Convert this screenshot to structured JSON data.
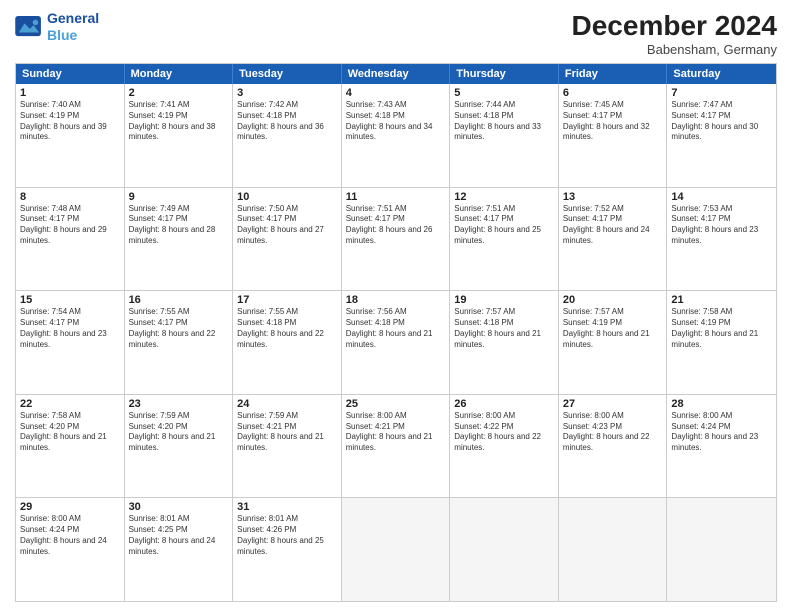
{
  "header": {
    "logo_line1": "General",
    "logo_line2": "Blue",
    "month": "December 2024",
    "location": "Babensham, Germany"
  },
  "days_of_week": [
    "Sunday",
    "Monday",
    "Tuesday",
    "Wednesday",
    "Thursday",
    "Friday",
    "Saturday"
  ],
  "weeks": [
    [
      {
        "day": "1",
        "sunrise": "7:40 AM",
        "sunset": "4:19 PM",
        "daylight": "8 hours and 39 minutes."
      },
      {
        "day": "2",
        "sunrise": "7:41 AM",
        "sunset": "4:19 PM",
        "daylight": "8 hours and 38 minutes."
      },
      {
        "day": "3",
        "sunrise": "7:42 AM",
        "sunset": "4:18 PM",
        "daylight": "8 hours and 36 minutes."
      },
      {
        "day": "4",
        "sunrise": "7:43 AM",
        "sunset": "4:18 PM",
        "daylight": "8 hours and 34 minutes."
      },
      {
        "day": "5",
        "sunrise": "7:44 AM",
        "sunset": "4:18 PM",
        "daylight": "8 hours and 33 minutes."
      },
      {
        "day": "6",
        "sunrise": "7:45 AM",
        "sunset": "4:17 PM",
        "daylight": "8 hours and 32 minutes."
      },
      {
        "day": "7",
        "sunrise": "7:47 AM",
        "sunset": "4:17 PM",
        "daylight": "8 hours and 30 minutes."
      }
    ],
    [
      {
        "day": "8",
        "sunrise": "7:48 AM",
        "sunset": "4:17 PM",
        "daylight": "8 hours and 29 minutes."
      },
      {
        "day": "9",
        "sunrise": "7:49 AM",
        "sunset": "4:17 PM",
        "daylight": "8 hours and 28 minutes."
      },
      {
        "day": "10",
        "sunrise": "7:50 AM",
        "sunset": "4:17 PM",
        "daylight": "8 hours and 27 minutes."
      },
      {
        "day": "11",
        "sunrise": "7:51 AM",
        "sunset": "4:17 PM",
        "daylight": "8 hours and 26 minutes."
      },
      {
        "day": "12",
        "sunrise": "7:51 AM",
        "sunset": "4:17 PM",
        "daylight": "8 hours and 25 minutes."
      },
      {
        "day": "13",
        "sunrise": "7:52 AM",
        "sunset": "4:17 PM",
        "daylight": "8 hours and 24 minutes."
      },
      {
        "day": "14",
        "sunrise": "7:53 AM",
        "sunset": "4:17 PM",
        "daylight": "8 hours and 23 minutes."
      }
    ],
    [
      {
        "day": "15",
        "sunrise": "7:54 AM",
        "sunset": "4:17 PM",
        "daylight": "8 hours and 23 minutes."
      },
      {
        "day": "16",
        "sunrise": "7:55 AM",
        "sunset": "4:17 PM",
        "daylight": "8 hours and 22 minutes."
      },
      {
        "day": "17",
        "sunrise": "7:55 AM",
        "sunset": "4:18 PM",
        "daylight": "8 hours and 22 minutes."
      },
      {
        "day": "18",
        "sunrise": "7:56 AM",
        "sunset": "4:18 PM",
        "daylight": "8 hours and 21 minutes."
      },
      {
        "day": "19",
        "sunrise": "7:57 AM",
        "sunset": "4:18 PM",
        "daylight": "8 hours and 21 minutes."
      },
      {
        "day": "20",
        "sunrise": "7:57 AM",
        "sunset": "4:19 PM",
        "daylight": "8 hours and 21 minutes."
      },
      {
        "day": "21",
        "sunrise": "7:58 AM",
        "sunset": "4:19 PM",
        "daylight": "8 hours and 21 minutes."
      }
    ],
    [
      {
        "day": "22",
        "sunrise": "7:58 AM",
        "sunset": "4:20 PM",
        "daylight": "8 hours and 21 minutes."
      },
      {
        "day": "23",
        "sunrise": "7:59 AM",
        "sunset": "4:20 PM",
        "daylight": "8 hours and 21 minutes."
      },
      {
        "day": "24",
        "sunrise": "7:59 AM",
        "sunset": "4:21 PM",
        "daylight": "8 hours and 21 minutes."
      },
      {
        "day": "25",
        "sunrise": "8:00 AM",
        "sunset": "4:21 PM",
        "daylight": "8 hours and 21 minutes."
      },
      {
        "day": "26",
        "sunrise": "8:00 AM",
        "sunset": "4:22 PM",
        "daylight": "8 hours and 22 minutes."
      },
      {
        "day": "27",
        "sunrise": "8:00 AM",
        "sunset": "4:23 PM",
        "daylight": "8 hours and 22 minutes."
      },
      {
        "day": "28",
        "sunrise": "8:00 AM",
        "sunset": "4:24 PM",
        "daylight": "8 hours and 23 minutes."
      }
    ],
    [
      {
        "day": "29",
        "sunrise": "8:00 AM",
        "sunset": "4:24 PM",
        "daylight": "8 hours and 24 minutes."
      },
      {
        "day": "30",
        "sunrise": "8:01 AM",
        "sunset": "4:25 PM",
        "daylight": "8 hours and 24 minutes."
      },
      {
        "day": "31",
        "sunrise": "8:01 AM",
        "sunset": "4:26 PM",
        "daylight": "8 hours and 25 minutes."
      },
      null,
      null,
      null,
      null
    ]
  ]
}
